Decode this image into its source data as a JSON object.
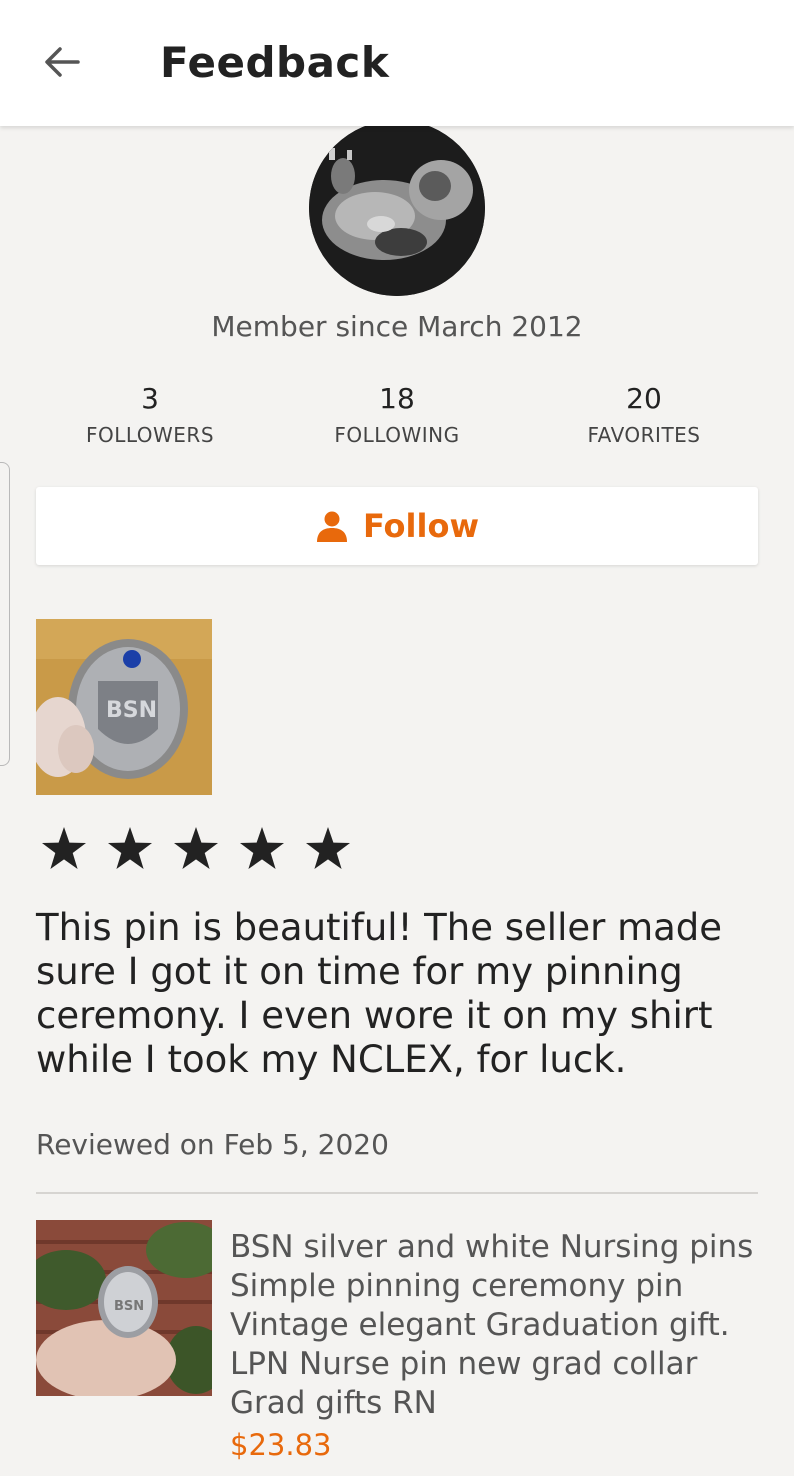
{
  "header": {
    "title": "Feedback",
    "back_icon": "arrow-left-icon"
  },
  "profile": {
    "avatar_icon": "ultrasound-photo-avatar",
    "member_since": "Member since March 2012",
    "stats": [
      {
        "value": "3",
        "label": "FOLLOWERS"
      },
      {
        "value": "18",
        "label": "FOLLOWING"
      },
      {
        "value": "20",
        "label": "FAVORITES"
      }
    ],
    "follow_button": {
      "label": "Follow",
      "icon": "person-icon"
    }
  },
  "review": {
    "photo": "review-photo-bsn-pin",
    "rating": 5,
    "rating_max": 5,
    "text": "This pin is beautiful! The seller made sure I got it on time for my pinning ceremony. I even wore it on my shirt while I took my NCLEX, for luck.",
    "reviewed_on": "Reviewed on Feb 5, 2020"
  },
  "product": {
    "photo": "product-photo-bsn-pin",
    "title": "BSN silver and white Nursing pins Simple pinning ceremony pin Vintage elegant Graduation gift. LPN Nurse pin new grad collar  Grad gifts RN",
    "price": "$23.83"
  },
  "colors": {
    "accent": "#e8690c",
    "background": "#f4f3f1",
    "header_bg": "#ffffff",
    "text": "#222222",
    "muted": "#555555"
  }
}
